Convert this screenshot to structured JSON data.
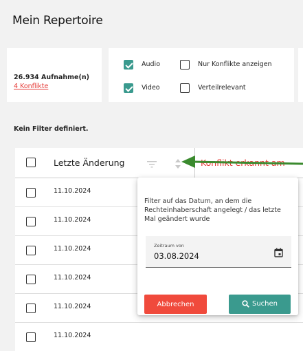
{
  "page": {
    "title": "Mein Repertoire"
  },
  "summary": {
    "count_text": "26.934 Aufnahme(n)",
    "conflicts_link": "4 Konflikte"
  },
  "filters": {
    "audio": {
      "label": "Audio",
      "checked": true
    },
    "video": {
      "label": "Video",
      "checked": true
    },
    "conflicts_only": {
      "label": "Nur Konflikte anzeigen",
      "checked": false
    },
    "distribution": {
      "label": "Verteilrelevant",
      "checked": false
    }
  },
  "filter_status": "Kein Filter definiert.",
  "table": {
    "columns": [
      "Letzte Änderung",
      "Konflikt erkannt am"
    ],
    "rows": [
      {
        "date": "11.10.2024"
      },
      {
        "date": "11.10.2024"
      },
      {
        "date": "11.10.2024"
      },
      {
        "date": "11.10.2024"
      },
      {
        "date": "11.10.2024"
      },
      {
        "date": "11.10.2024"
      }
    ]
  },
  "popover": {
    "description": "Filter auf das Datum, an dem die Rechteinhaberschaft angelegt / das letzte Mal geändert wurde",
    "date_field_label": "Zeitraum von",
    "date_field_value": "03.08.2024",
    "cancel_label": "Abbrechen",
    "search_label": "Suchen"
  },
  "colors": {
    "accent": "#3a9a8e",
    "danger": "#f04a3c",
    "arrow": "#3a8a2e"
  },
  "icons": [
    "filter-icon",
    "sort-icon",
    "calendar-icon",
    "search-icon",
    "arrow-pointer"
  ]
}
